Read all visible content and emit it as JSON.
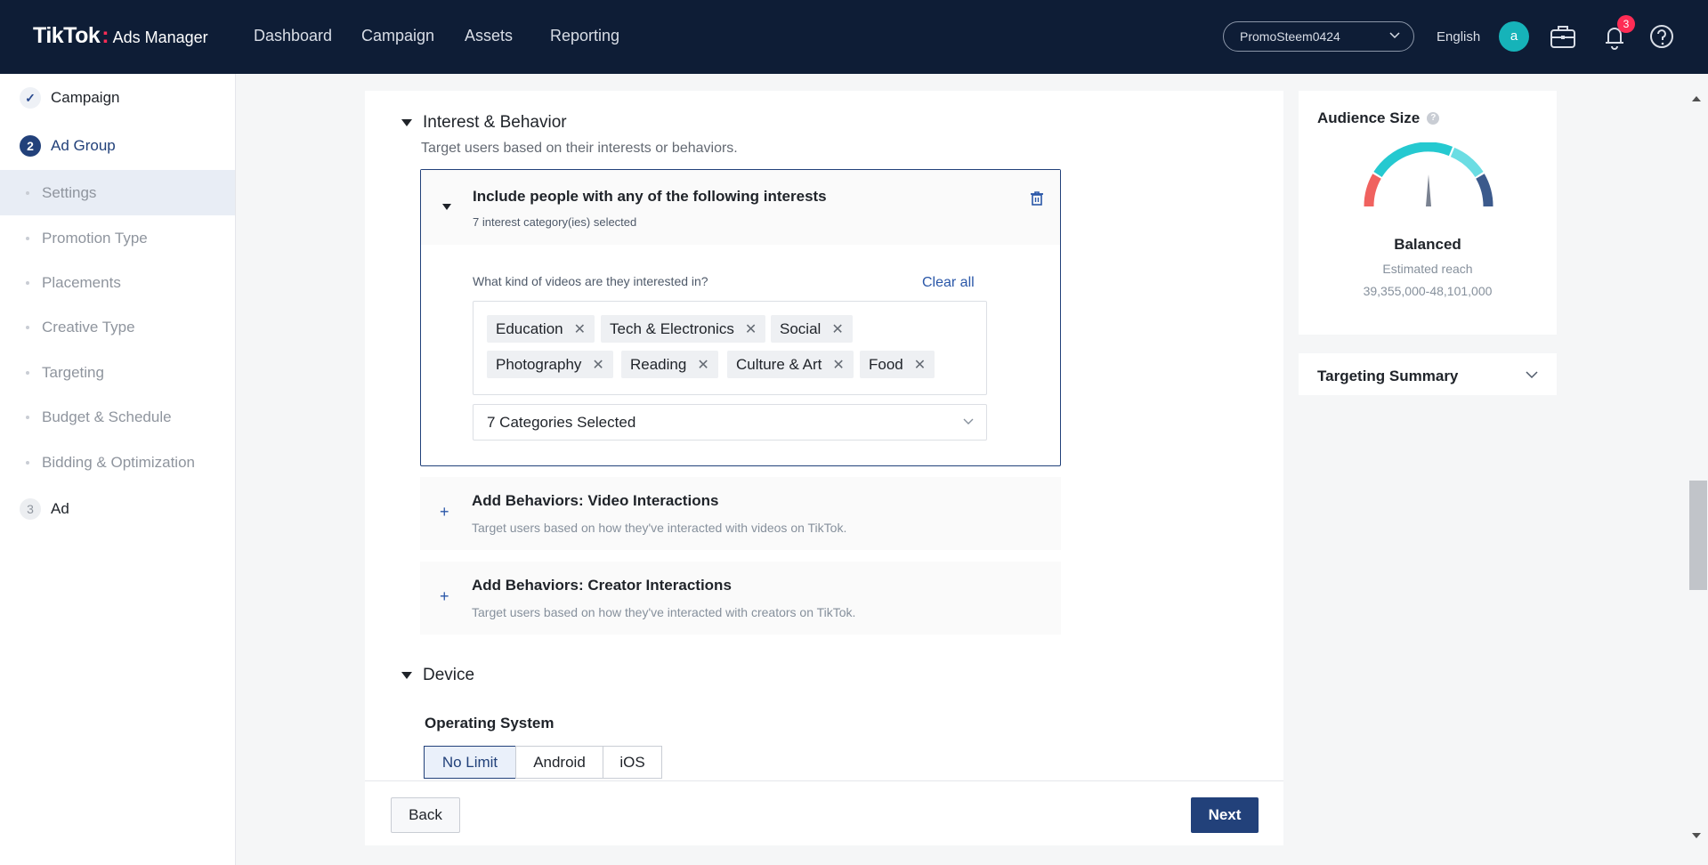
{
  "header": {
    "brand": "TikTok",
    "product": "Ads Manager",
    "nav": [
      "Dashboard",
      "Campaign",
      "Assets",
      "Reporting"
    ],
    "account": "PromoSteem0424",
    "language": "English",
    "avatar_letter": "a",
    "notifications_count": "3"
  },
  "sidebar": {
    "steps": [
      {
        "num": "✓",
        "label": "Campaign"
      },
      {
        "num": "2",
        "label": "Ad Group"
      },
      {
        "num": "3",
        "label": "Ad"
      }
    ],
    "sub_items": [
      "Settings",
      "Promotion Type",
      "Placements",
      "Creative Type",
      "Targeting",
      "Budget & Schedule",
      "Bidding & Optimization"
    ]
  },
  "interest_behavior": {
    "heading": "Interest & Behavior",
    "description": "Target users based on their interests or behaviors.",
    "include_title": "Include people with any of the following interests",
    "include_sub": "7 interest category(ies) selected",
    "question": "What kind of videos are they interested in?",
    "clear_all": "Clear all",
    "tags": [
      "Education",
      "Tech & Electronics",
      "Social",
      "Photography",
      "Reading",
      "Culture & Art",
      "Food"
    ],
    "categories_selected": "7 Categories Selected",
    "video_title": "Add Behaviors: Video Interactions",
    "video_desc": "Target users based on how they've interacted with videos on TikTok.",
    "creator_title": "Add Behaviors: Creator Interactions",
    "creator_desc": "Target users based on how they've interacted with creators on TikTok."
  },
  "device": {
    "heading": "Device",
    "os_label": "Operating System",
    "options": [
      "No Limit",
      "Android",
      "iOS"
    ]
  },
  "footer": {
    "back": "Back",
    "next": "Next"
  },
  "audience": {
    "title": "Audience Size",
    "help": "?",
    "status": "Balanced",
    "reach_label": "Estimated reach",
    "reach_value": "39,355,000-48,101,000"
  },
  "summary": {
    "title": "Targeting Summary"
  },
  "colors": {
    "nav_bg": "#0e1d36",
    "primary": "#22417a",
    "link": "#2a57a8",
    "gauge_red": "#f0625f",
    "gauge_teal": "#25c9d0",
    "gauge_light": "#6bdde3",
    "gauge_navy": "#3c5a8c"
  }
}
